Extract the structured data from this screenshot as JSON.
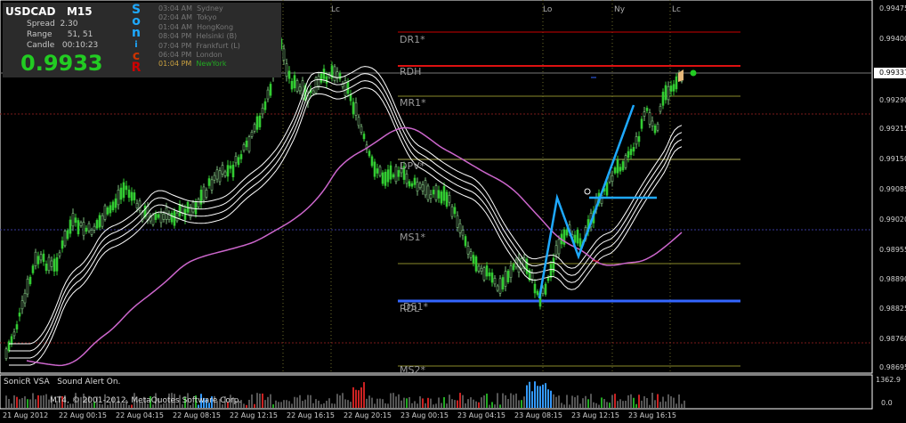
{
  "header": {
    "symbol": "USDCAD",
    "timeframe": "M15",
    "spread_label": "Spread",
    "spread_value": "2.30",
    "range_label": "Range",
    "range_value": "51, 51",
    "candle_label": "Candle",
    "candle_value": "00:10:23",
    "price": "0.9933"
  },
  "brand_letters": [
    "S",
    "o",
    "n",
    "i",
    "c",
    "R"
  ],
  "sessions": [
    {
      "time": "03:04 AM",
      "city": "Sydney"
    },
    {
      "time": "02:04 AM",
      "city": "Tokyo"
    },
    {
      "time": "01:04 AM",
      "city": "HongKong"
    },
    {
      "time": "08:04 PM",
      "city": "Helsinki  (B)"
    },
    {
      "time": "07:04 PM",
      "city": "Frankfurt  (L)"
    },
    {
      "time": "06:04 PM",
      "city": "London"
    },
    {
      "time": "01:04 PM",
      "city": "NewYork"
    }
  ],
  "session_markers": [
    "Lc",
    "Lo",
    "Ny",
    "Lc"
  ],
  "levels": {
    "dr1": "DR1*",
    "rdh": "RDH",
    "mr1": "MR1*",
    "dpv": "DPV*",
    "ms1": "MS1*",
    "rdl": "RDL",
    "ds1": "DS1*",
    "ms2": "MS2*"
  },
  "price_axis": [
    "0.99475",
    "0.99400",
    "0.99337",
    "0.99290",
    "0.99215",
    "0.99150",
    "0.99085",
    "0.99020",
    "0.98955",
    "0.98890",
    "0.98825",
    "0.98760",
    "0.98695"
  ],
  "time_axis": [
    "21 Aug 2012",
    "22 Aug 00:15",
    "22 Aug 04:15",
    "22 Aug 08:15",
    "22 Aug 12:15",
    "22 Aug 16:15",
    "22 Aug 20:15",
    "23 Aug 00:15",
    "23 Aug 04:15",
    "23 Aug 08:15",
    "23 Aug 12:15",
    "23 Aug 16:15"
  ],
  "subwindow": {
    "indicator": "SonicR VSA",
    "alert": "Sound Alert On.",
    "copyright": "MT4, © 2001-2012, MetaQuotes Software Corp.",
    "max": "1362.9",
    "min": "0.0"
  },
  "colors": {
    "bull": "#33cc33",
    "bear": "#7fbf7f",
    "pivot_red": "#cc0000",
    "pivot_olive": "#8a8a2a",
    "ma_pink": "#cc66cc",
    "envelope": "#ffffff",
    "swing": "#1ea9ff",
    "support": "#3366ff",
    "price_green": "#22cc22",
    "vol_blue": "#3399ff",
    "vol_red": "#cc2222",
    "vol_green": "#22aa22",
    "vol_gray": "#555555"
  }
}
